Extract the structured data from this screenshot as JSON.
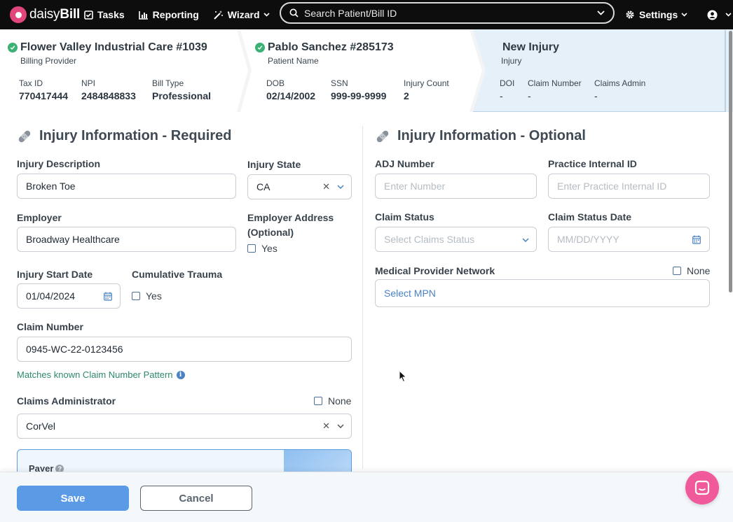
{
  "navbar": {
    "logo_light": "daisy",
    "logo_bold": "Bill",
    "tasks": "Tasks",
    "reporting": "Reporting",
    "wizard": "Wizard",
    "search_placeholder": "Search Patient/Bill ID",
    "settings": "Settings"
  },
  "breadcrumb": {
    "provider": {
      "title": "Flower Valley Industrial Care #1039",
      "subtitle": "Billing Provider",
      "fields": [
        {
          "label": "Tax ID",
          "value": "770417444"
        },
        {
          "label": "NPI",
          "value": "2484848833"
        },
        {
          "label": "Bill Type",
          "value": "Professional"
        }
      ]
    },
    "patient": {
      "title": "Pablo Sanchez #285173",
      "subtitle": "Patient Name",
      "fields": [
        {
          "label": "DOB",
          "value": "02/14/2002"
        },
        {
          "label": "SSN",
          "value": "999-99-9999"
        },
        {
          "label": "Injury Count",
          "value": "2"
        }
      ]
    },
    "injury": {
      "title": "New Injury",
      "subtitle": "Injury",
      "fields": [
        {
          "label": "DOI",
          "value": "-"
        },
        {
          "label": "Claim Number",
          "value": "-"
        },
        {
          "label": "Claims Admin",
          "value": "-"
        }
      ]
    }
  },
  "required": {
    "title": "Injury Information - Required",
    "injury_description_label": "Injury Description",
    "injury_description_value": "Broken Toe",
    "injury_state_label": "Injury State",
    "injury_state_value": "CA",
    "employer_label": "Employer",
    "employer_value": "Broadway Healthcare",
    "employer_address_label_1": "Employer Address",
    "employer_address_label_2": "(Optional)",
    "employer_address_yes": "Yes",
    "injury_start_label": "Injury Start Date",
    "injury_start_value": "01/04/2024",
    "cumulative_label": "Cumulative Trauma",
    "cumulative_yes": "Yes",
    "claim_number_label": "Claim Number",
    "claim_number_value": "0945-WC-22-0123456",
    "claim_match_text": "Matches known Claim Number Pattern",
    "claims_admin_label": "Claims Administrator",
    "claims_admin_none": "None",
    "claims_admin_value": "CorVel",
    "payer_label": "Payer"
  },
  "optional": {
    "title": "Injury Information - Optional",
    "adj_label": "ADJ Number",
    "adj_placeholder": "Enter Number",
    "internal_id_label": "Practice Internal ID",
    "internal_id_placeholder": "Enter Practice Internal ID",
    "claim_status_label": "Claim Status",
    "claim_status_placeholder": "Select Claims Status",
    "claim_status_date_label": "Claim Status Date",
    "claim_status_date_placeholder": "MM/DD/YYYY",
    "mpn_label": "Medical Provider Network",
    "mpn_none": "None",
    "mpn_placeholder": "Select MPN"
  },
  "footer": {
    "save": "Save",
    "cancel": "Cancel"
  },
  "colors": {
    "navbar_bg": "#0d0d0d",
    "accent_blue": "#5b9be6",
    "success_green": "#3bb273",
    "brand_pink": "#e0457b",
    "chat_pink": "#f15a9a"
  }
}
